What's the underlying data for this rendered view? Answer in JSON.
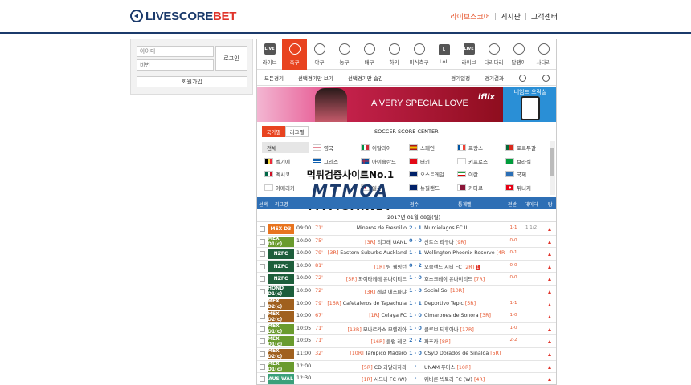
{
  "brand": {
    "logo_main": "LIVESCORE",
    "logo_accent": "BET"
  },
  "topnav": [
    "라이브스코어",
    "게시판",
    "고객센터"
  ],
  "login": {
    "id_placeholder": "아이디",
    "pw_placeholder": "비번",
    "login_label": "로그인",
    "join_label": "회원가입"
  },
  "sports": [
    {
      "icon": "live-icon",
      "label": "라이브"
    },
    {
      "icon": "soccer-ball-icon",
      "label": "축구"
    },
    {
      "icon": "baseball-icon",
      "label": "야구"
    },
    {
      "icon": "basketball-icon",
      "label": "농구"
    },
    {
      "icon": "volleyball-icon",
      "label": "배구"
    },
    {
      "icon": "hockey-icon",
      "label": "하키"
    },
    {
      "icon": "american-football-icon",
      "label": "미식축구"
    },
    {
      "icon": "lol-icon",
      "label": "LoL"
    },
    {
      "icon": "live-icon",
      "label": "라이브"
    },
    {
      "icon": "ladder-icon",
      "label": "다리다리"
    },
    {
      "icon": "dart-icon",
      "label": "달팽이"
    },
    {
      "icon": "ladder-icon",
      "label": "사다리"
    }
  ],
  "subnav": {
    "items": [
      "모든경기",
      "선택경기만 보기",
      "선택경기만 숨김"
    ],
    "right": [
      "경기일정",
      "경기결과"
    ]
  },
  "banner": {
    "headline": "A VERY SPECIAL LOVE",
    "brand": "iflix",
    "side_text": "네임드 오락실",
    "side_icon": "phone-icon"
  },
  "score_center": {
    "tabs": [
      "국가별",
      "리그별"
    ],
    "title": "SOCCER SCORE CENTER"
  },
  "countries": [
    [
      {
        "name": "전체",
        "flag": "none"
      },
      {
        "name": "영국",
        "flag": "gb"
      },
      {
        "name": "이탈리아",
        "flag": "it"
      },
      {
        "name": "스페인",
        "flag": "es"
      },
      {
        "name": "프랑스",
        "flag": "fr"
      },
      {
        "name": "포르투갈",
        "flag": "pt"
      }
    ],
    [
      {
        "name": "벨기에",
        "flag": "be"
      },
      {
        "name": "그리스",
        "flag": "gr"
      },
      {
        "name": "아이슬란드",
        "flag": "is"
      },
      {
        "name": "터키",
        "flag": "tr"
      },
      {
        "name": "키프로스",
        "flag": "cy"
      },
      {
        "name": "브라질",
        "flag": "br"
      }
    ],
    [
      {
        "name": "멕시코",
        "flag": "mx"
      },
      {
        "name": "",
        "flag": "none"
      },
      {
        "name": "",
        "flag": "none"
      },
      {
        "name": "오스트레일...",
        "flag": "au"
      },
      {
        "name": "이란",
        "flag": "ir"
      },
      {
        "name": "국제",
        "flag": "intl"
      }
    ],
    [
      {
        "name": "아메리카",
        "flag": "am"
      },
      {
        "name": "",
        "flag": "none"
      },
      {
        "name": "일본",
        "flag": "jp"
      },
      {
        "name": "뉴질랜드",
        "flag": "nz"
      },
      {
        "name": "카타르",
        "flag": "qa"
      },
      {
        "name": "튀니지",
        "flag": "tn"
      }
    ]
  ],
  "watermark": {
    "line1": "먹튀검증사이트No.1",
    "line2": "MTMOA",
    "line3": "MTMOA.NET"
  },
  "table_header": {
    "select": "선택",
    "league": "리그명",
    "score": "점수",
    "stats": "통계벨",
    "half": "전반",
    "data": "데이터",
    "alarm": "탐"
  },
  "date_label": "2017년 01월 08일(일)",
  "matches": [
    {
      "league": "MEX D3",
      "lc": "#e8741f",
      "time": "09:00",
      "min": "71'",
      "home": "Mineros de Fresnillo",
      "hrank": "",
      "score": "2 - 1",
      "away": "Murcielagos FC II",
      "arank": "",
      "red": "",
      "half": "1-1",
      "data": "1 1/2"
    },
    {
      "league": "MEX D1(c)",
      "lc": "#6a9b2e",
      "time": "10:00",
      "min": "75'",
      "home": "티그레 UANL",
      "hrank": "[3R]",
      "score": "0 - 0",
      "away": "산토스 라구나",
      "arank": "[9R]",
      "red": "",
      "half": "0-0",
      "data": ""
    },
    {
      "league": "NZFC",
      "lc": "#1d5e3b",
      "time": "10:00",
      "min": "79'",
      "home": "Eastern Suburbs Auckland",
      "hrank": "[3R]",
      "score": "1 - 1",
      "away": "Wellington Phoenix Reserve",
      "arank": "[4R]",
      "red": "",
      "half": "0-1",
      "data": ""
    },
    {
      "league": "NZFC",
      "lc": "#1d5e3b",
      "time": "10:00",
      "min": "81'",
      "home": "팀 웰링턴",
      "hrank": "[1R]",
      "score": "0 - 2",
      "away": "오클랜드 시티 FC",
      "arank": "[2R]",
      "red": "1",
      "half": "0-0",
      "data": ""
    },
    {
      "league": "NZFC",
      "lc": "#1d5e3b",
      "time": "10:00",
      "min": "72'",
      "home": "와이타케레 유나이티드",
      "hrank": "[5R]",
      "score": "1 - 0",
      "away": "호스크베이 유나이티드",
      "arank": "[7R]",
      "red": "",
      "half": "0-0",
      "data": ""
    },
    {
      "league": "HOND D1(c)",
      "lc": "#1d5e3b",
      "time": "10:00",
      "min": "72'",
      "home": "레알 에스파냐",
      "hrank": "[3R]",
      "score": "1 - 0",
      "away": "Social Sol",
      "arank": "[10R]",
      "red": "",
      "half": "",
      "data": ""
    },
    {
      "league": "MEX D2(c)",
      "lc": "#a0601e",
      "time": "10:00",
      "min": "79'",
      "home": "Cafetaleros de Tapachula",
      "hrank": "[16R]",
      "score": "1 - 1",
      "away": "Deportivo Tepic",
      "arank": "[5R]",
      "red": "",
      "half": "1-1",
      "data": ""
    },
    {
      "league": "MEX D2(c)",
      "lc": "#a0601e",
      "time": "10:00",
      "min": "67'",
      "home": "Celaya FC",
      "hrank": "[1R]",
      "score": "1 - 0",
      "away": "Cimarones de Sonora",
      "arank": "[3R]",
      "red": "",
      "half": "1-0",
      "data": ""
    },
    {
      "league": "MEX D1(c)",
      "lc": "#6a9b2e",
      "time": "10:05",
      "min": "71'",
      "home": "모나르카스 모렐리아",
      "hrank": "[13R]",
      "score": "1 - 0",
      "away": "클루브 티후아나",
      "arank": "[17R]",
      "red": "",
      "half": "1-0",
      "data": ""
    },
    {
      "league": "MEX D1(c)",
      "lc": "#6a9b2e",
      "time": "10:05",
      "min": "71'",
      "home": "클럽 레온",
      "hrank": "[16R]",
      "score": "2 - 2",
      "away": "파추카",
      "arank": "[8R]",
      "red": "",
      "half": "2-2",
      "data": ""
    },
    {
      "league": "MEX D2(c)",
      "lc": "#a0601e",
      "time": "11:00",
      "min": "32'",
      "home": "Tampico Madero",
      "hrank": "[10R]",
      "score": "1 - 0",
      "away": "CSyD Dorados de Sinaloa",
      "arank": "[5R]",
      "red": "",
      "half": "",
      "data": ""
    },
    {
      "league": "MEX D1(c)",
      "lc": "#6a9b2e",
      "time": "12:00",
      "min": "",
      "home": "CD 과달라하라",
      "hrank": "[5R]",
      "score": "-",
      "away": "UNAM 푸마스",
      "arank": "[10R]",
      "red": "",
      "half": "",
      "data": ""
    },
    {
      "league": "AUS WAL",
      "lc": "#3aa07a",
      "time": "12:30",
      "min": "",
      "home": "시드니 FC (W)",
      "hrank": "[1R]",
      "score": "-",
      "away": "웨버른 빅토리 FC (W)",
      "arank": "[4R]",
      "red": "",
      "half": "",
      "data": ""
    }
  ]
}
